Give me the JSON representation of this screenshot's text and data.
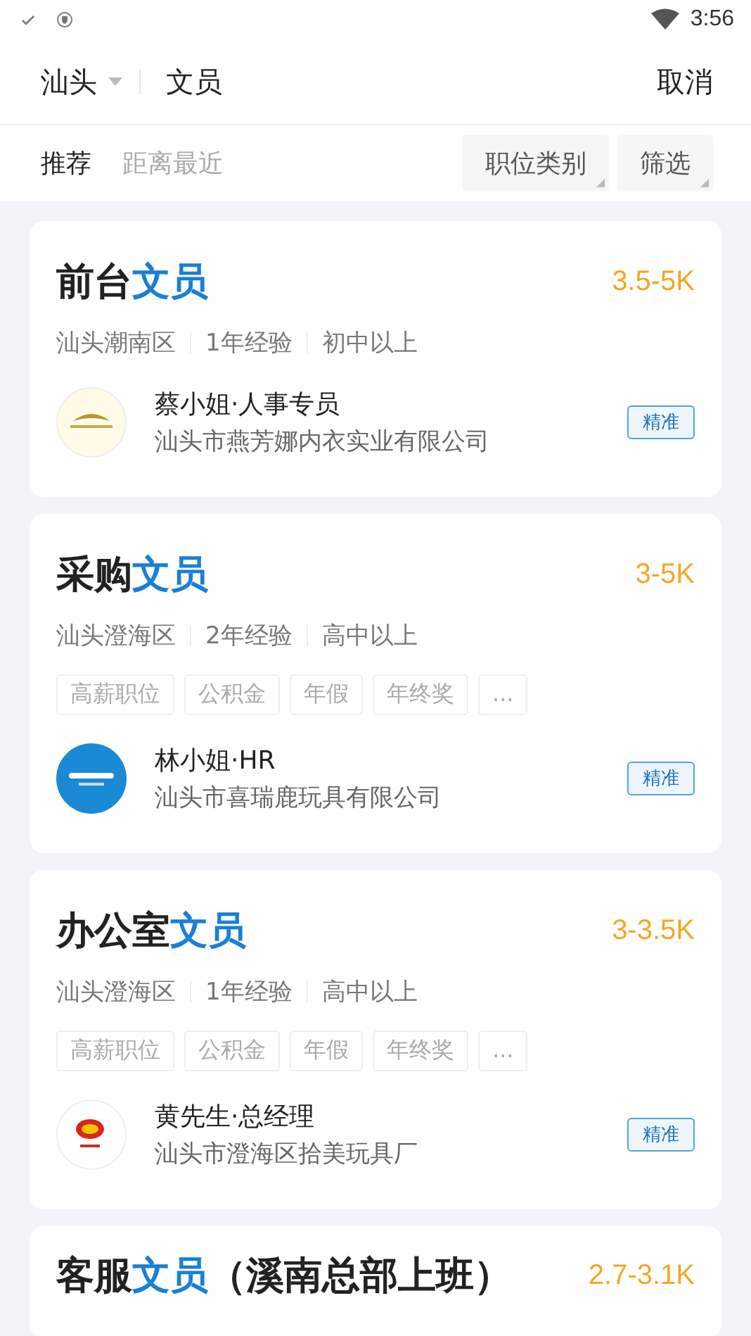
{
  "status_bar": {
    "time": "3:56"
  },
  "header": {
    "city": "汕头",
    "query": "文员",
    "cancel": "取消"
  },
  "sort_tabs": [
    {
      "label": "推荐",
      "selected": true
    },
    {
      "label": "距离最近",
      "selected": false
    }
  ],
  "filters": [
    "职位类别",
    "筛选"
  ],
  "jobs": [
    {
      "title_prefix": "前台",
      "title_highlight": "文员",
      "salary": "3.5-5K",
      "meta": [
        "汕头潮南区",
        "1年经验",
        "初中以上"
      ],
      "recruiter": "蔡小姐·人事专员",
      "company": "汕头市燕芳娜内衣实业有限公司",
      "badge": "精准",
      "logo": {
        "kind": "crest"
      }
    },
    {
      "title_prefix": "采购",
      "title_highlight": "文员",
      "salary": "3-5K",
      "meta": [
        "汕头澄海区",
        "2年经验",
        "高中以上"
      ],
      "tags": [
        "高薪职位",
        "公积金",
        "年假",
        "年终奖",
        "..."
      ],
      "recruiter": "林小姐·HR",
      "company": "汕头市喜瑞鹿玩具有限公司",
      "badge": "精准",
      "logo": {
        "kind": "disc"
      }
    },
    {
      "title_prefix": "办公室",
      "title_highlight": "文员",
      "salary": "3-3.5K",
      "meta": [
        "汕头澄海区",
        "1年经验",
        "高中以上"
      ],
      "tags": [
        "高薪职位",
        "公积金",
        "年假",
        "年终奖",
        "..."
      ],
      "recruiter": "黄先生·总经理",
      "company": "汕头市澄海区拾美玩具厂",
      "badge": "精准",
      "logo": {
        "kind": "emblem"
      }
    },
    {
      "title_prefix": "客服",
      "title_highlight": "文员",
      "title_suffix": "（溪南总部上班）",
      "salary": "2.7-3.1K"
    }
  ]
}
